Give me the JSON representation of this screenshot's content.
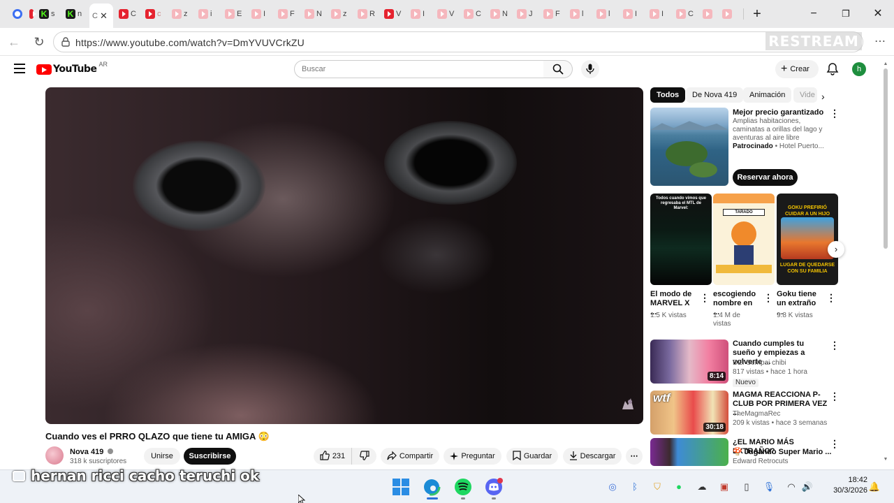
{
  "browser": {
    "active_tab_label": "C",
    "tab_fragments": [
      "s",
      "n",
      "C",
      "c",
      "z",
      "i",
      "E",
      "I",
      "F",
      "N",
      "z",
      "R",
      "V",
      "I",
      "V",
      "C",
      "N",
      "J",
      "F",
      "l",
      "l",
      "I",
      "I",
      "C"
    ],
    "url": "https://www.youtube.com/watch?v=DmYVUVCrkZU",
    "restream_watermark": "RESTREAM",
    "new_tab_symbol": "+"
  },
  "youtube": {
    "logo_text": "YouTube",
    "country_code": "AR",
    "search_placeholder": "Buscar",
    "create_label": "Crear",
    "avatar_letter": "h"
  },
  "video": {
    "title": "Cuando ves el PRRO QLAZO que tiene tu AMIGA 😳",
    "channel_name": "Nova 419",
    "channel_verified_icon": "verified-icon",
    "subscribers": "318 k suscriptores",
    "join_label": "Unirse",
    "subscribe_label": "Suscribirse",
    "likes": "231",
    "share_label": "Compartir",
    "ask_label": "Preguntar",
    "save_label": "Guardar",
    "download_label": "Descargar"
  },
  "chips": [
    "Todos",
    "De Nova 419",
    "Animación",
    "Vide"
  ],
  "ad": {
    "title": "Mejor precio garantizado",
    "description": "Amplias habitaciones, caminatas a orillas del lago y aventuras al aire libre",
    "sponsored_label": "Patrocinado",
    "advertiser": "Hotel Puerto...",
    "cta_label": "Reservar ahora"
  },
  "shorts": [
    {
      "title": "El modo de MARVEL X ...",
      "views": "1.5 K vistas",
      "thumb_caption": "Todos cuando vimos que regresaba el MTL de Marvel:"
    },
    {
      "title": "escogiendo nombre en ...",
      "views": "1.4 M de vistas",
      "thumb_caption": "TARADO"
    },
    {
      "title": "Goku tiene un extraño ...",
      "views": "9.8 K vistas",
      "thumb_caption_top": "GOKU PREFIRIÓ CUIDAR A UN HIJO AJENO EN",
      "thumb_caption_bottom": "LUGAR DE QUEDARSE CON SU FAMILIA"
    }
  ],
  "recommendations": [
    {
      "title": "Cuando cumples tu sueño y empiezas a volverte ...",
      "channel": "DEI Sempai chibi",
      "meta": "817 vistas • hace 1 hora",
      "badge": "Nuevo",
      "duration": "8:14"
    },
    {
      "title": "MAGMA REACCIONA P-CLUB POR PRIMERA VEZ ...",
      "channel": "TheMagmaRec",
      "meta": "209 k vistas • hace 3 semanas",
      "duration": "30:18",
      "thumb_text": "wtf"
    },
    {
      "title": "¿EL MARIO MÁS EXTRAÑO?",
      "subtitle": "Jugando Super Mario ...",
      "channel": "Edward Retrocuts"
    }
  ],
  "overlay_text": "hernan ricci cacho teruchi ok",
  "taskbar": {
    "time": "18:42",
    "date": "30/3/2026"
  },
  "colors": {
    "youtube_red": "#ff0000",
    "kick_green": "#53fc18",
    "avatar_green": "#1e8e3e",
    "dark_button": "#0f0f0f"
  }
}
